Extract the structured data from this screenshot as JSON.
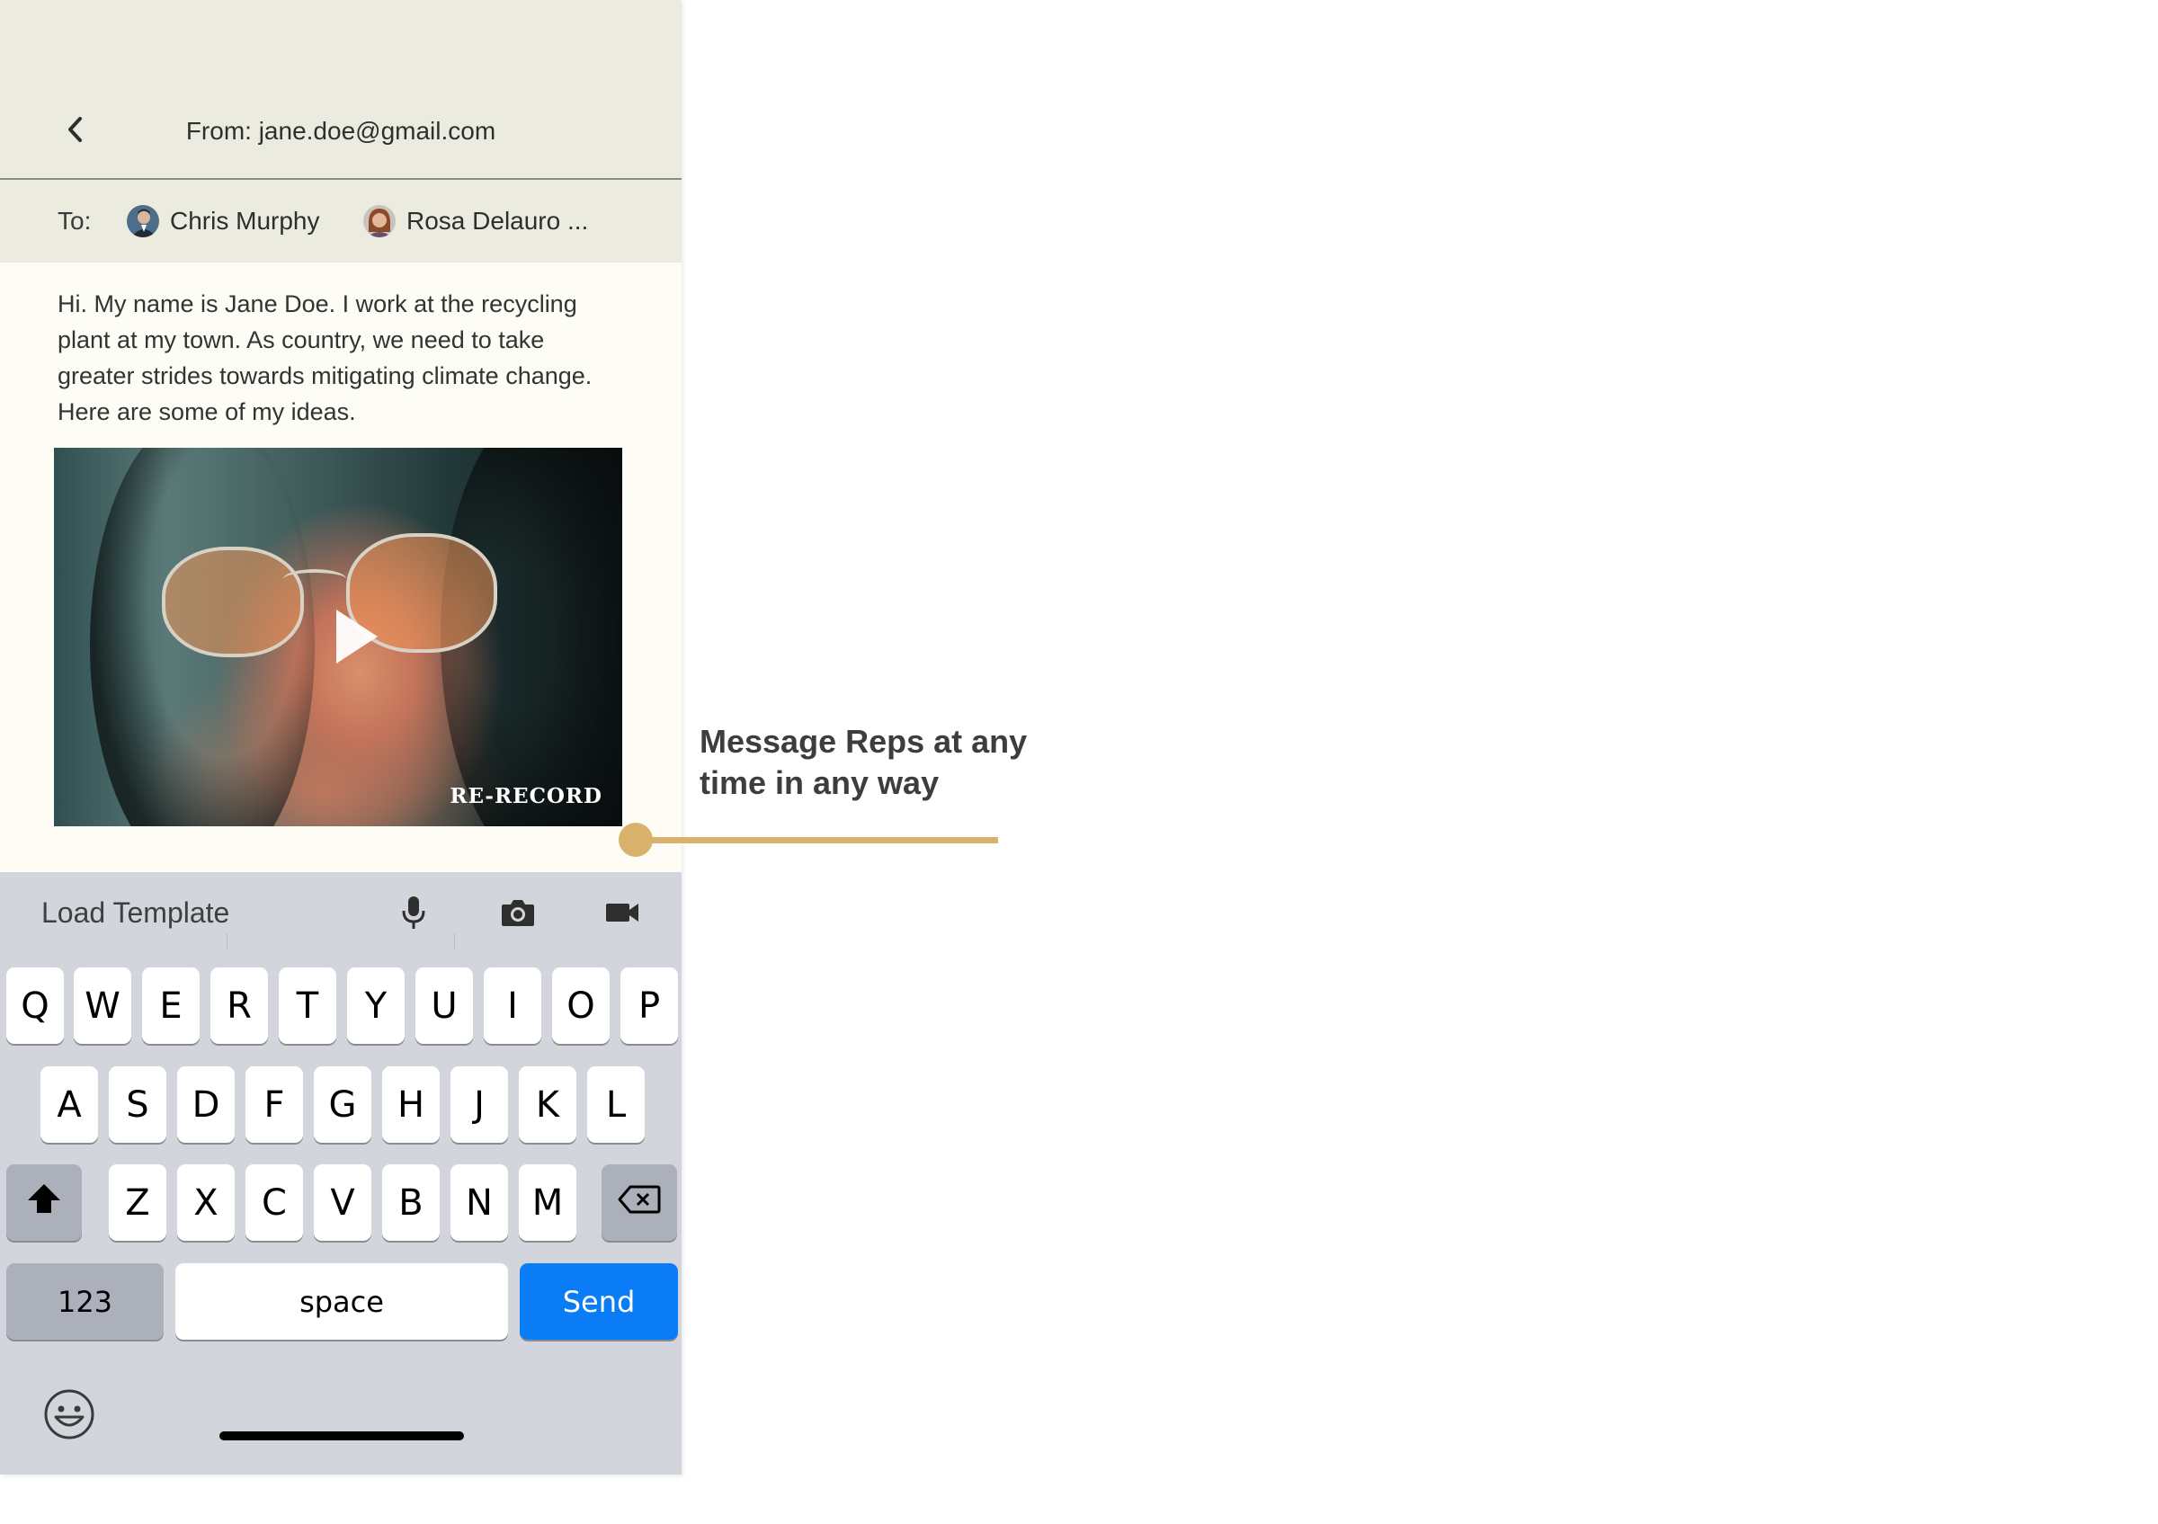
{
  "header": {
    "back_icon": "chevron-left-icon",
    "from_text": "From: jane.doe@gmail.com"
  },
  "recipients": {
    "to_label": "To:",
    "items": [
      {
        "name": "Chris Murphy",
        "avatar": "avatar"
      },
      {
        "name": "Rosa Delauro ...",
        "avatar": "avatar"
      }
    ]
  },
  "message": {
    "body": "Hi. My name is Jane Doe. I work at the recycling plant at my town. As country, we need to take greater strides towards mitigating climate change. Here are some of my ideas."
  },
  "video": {
    "play_icon": "play-icon",
    "rerecord_label": "RE-RECORD"
  },
  "toolbar": {
    "load_template_label": "Load Template",
    "icons": [
      "microphone-icon",
      "camera-icon",
      "video-camera-icon"
    ]
  },
  "keyboard": {
    "row1": [
      "Q",
      "W",
      "E",
      "R",
      "T",
      "Y",
      "U",
      "I",
      "O",
      "P"
    ],
    "row2": [
      "A",
      "S",
      "D",
      "F",
      "G",
      "H",
      "J",
      "K",
      "L"
    ],
    "row3": [
      "Z",
      "X",
      "C",
      "V",
      "B",
      "N",
      "M"
    ],
    "shift_icon": "shift-icon",
    "delete_icon": "backspace-icon",
    "numbers_label": "123",
    "space_label": "space",
    "send_label": "Send",
    "emoji_icon": "emoji-icon"
  },
  "callout": {
    "text": "Message Reps at any time in any way"
  },
  "colors": {
    "header_bg": "#ecebdf",
    "content_bg": "#fdfdf6",
    "keyboard_bg": "#d2d5db",
    "send_blue": "#0a7cf6",
    "callout_gold": "#d9b26c"
  }
}
